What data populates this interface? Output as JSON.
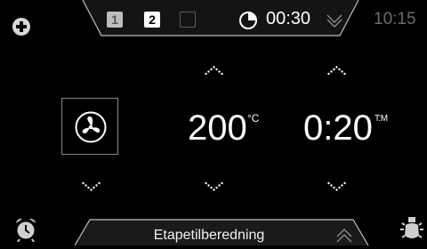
{
  "top_bar": {
    "stages": [
      {
        "label": "1"
      },
      {
        "label": "2"
      },
      {
        "label": ""
      }
    ],
    "timer": {
      "icon": "clock-pie-icon",
      "value": "00:30"
    },
    "expand_icon": "double-chevron-down-icon"
  },
  "clock": "10:15",
  "add_icon": "plus-circle-icon",
  "fan_icon": "fan-icon",
  "temperature": {
    "value": "200",
    "unit": "°C"
  },
  "duration": {
    "value": "0:20",
    "unit": "T:M"
  },
  "bottom_bar": {
    "label": "Etapetilberedning",
    "expand_icon": "double-chevron-up-icon"
  },
  "alarm_icon": "alarm-clock-icon",
  "light_icon": "oven-light-icon",
  "colors": {
    "background": "#000000",
    "tab_border": "#bfbfbf",
    "dim_text": "#6b6b6b",
    "bright_text": "#ffffff"
  }
}
